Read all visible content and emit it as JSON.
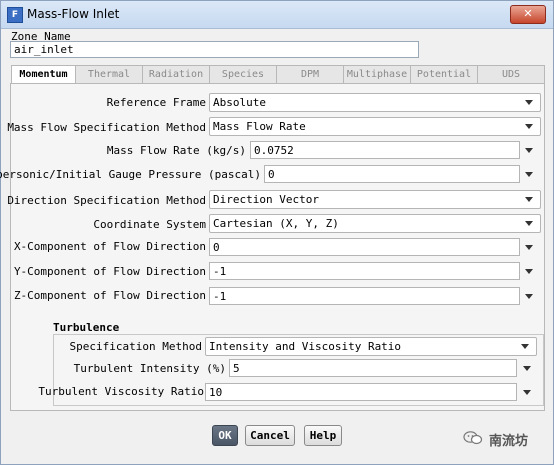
{
  "window": {
    "title": "Mass-Flow Inlet",
    "close_glyph": "✕",
    "icon_letter": "F"
  },
  "zone": {
    "label": "Zone Name",
    "value": "air_inlet"
  },
  "tabs": [
    "Momentum",
    "Thermal",
    "Radiation",
    "Species",
    "DPM",
    "Multiphase",
    "Potential",
    "UDS"
  ],
  "momentum": {
    "reference_frame": {
      "label": "Reference Frame",
      "value": "Absolute"
    },
    "mass_flow_method": {
      "label": "Mass Flow Specification Method",
      "value": "Mass Flow Rate"
    },
    "mass_flow_rate": {
      "label": "Mass Flow Rate (kg/s)",
      "value": "0.0752"
    },
    "gauge_pressure": {
      "label": "Supersonic/Initial Gauge Pressure (pascal)",
      "value": "0"
    },
    "direction_method": {
      "label": "Direction Specification Method",
      "value": "Direction Vector"
    },
    "coordinate_system": {
      "label": "Coordinate System",
      "value": "Cartesian (X, Y, Z)"
    },
    "x_component": {
      "label": "X-Component of Flow Direction",
      "value": "0"
    },
    "y_component": {
      "label": "Y-Component of Flow Direction",
      "value": "-1"
    },
    "z_component": {
      "label": "Z-Component of Flow Direction",
      "value": "-1"
    }
  },
  "turbulence": {
    "heading": "Turbulence",
    "spec_method": {
      "label": "Specification Method",
      "value": "Intensity and Viscosity Ratio"
    },
    "intensity": {
      "label": "Turbulent Intensity (%)",
      "value": "5"
    },
    "viscosity_ratio": {
      "label": "Turbulent Viscosity Ratio",
      "value": "10"
    }
  },
  "buttons": {
    "ok": "OK",
    "cancel": "Cancel",
    "help": "Help"
  },
  "watermark": {
    "text": "南流坊",
    "icon": "wechat-icon"
  }
}
